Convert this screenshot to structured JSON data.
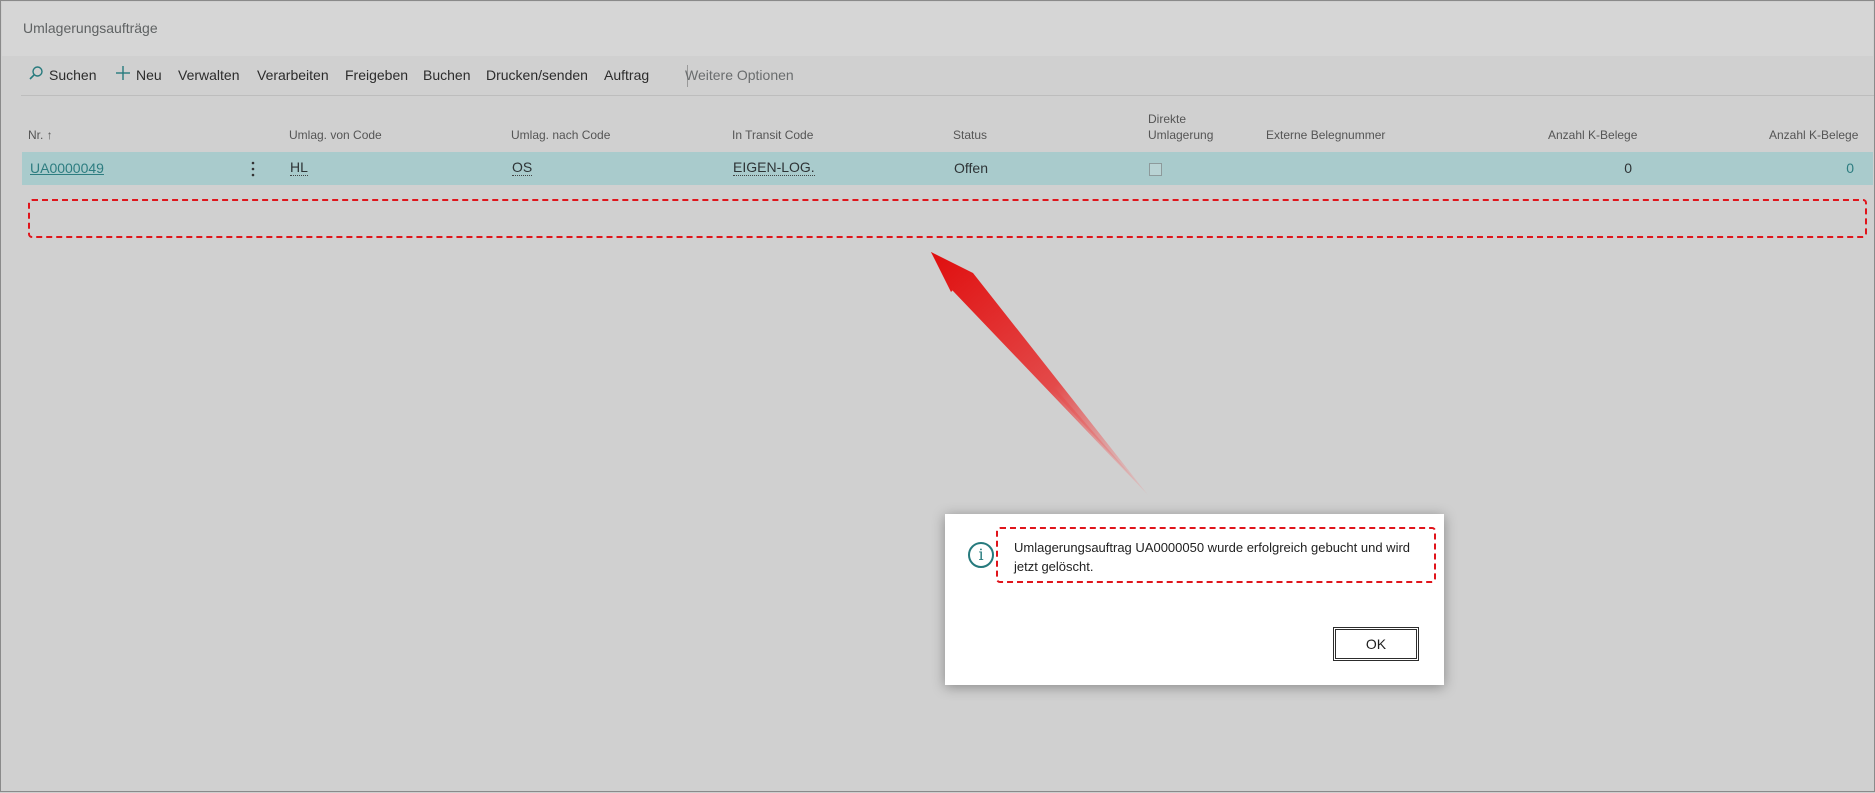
{
  "page": {
    "title": "Umlagerungsaufträge"
  },
  "actions": {
    "search": "Suchen",
    "new": "Neu",
    "manage": "Verwalten",
    "process": "Verarbeiten",
    "release": "Freigeben",
    "post": "Buchen",
    "print_send": "Drucken/senden",
    "order": "Auftrag",
    "more_options": "Weitere Optionen"
  },
  "table": {
    "columns": {
      "nr": "Nr. ↑",
      "from_code": "Umlag. von Code",
      "to_code": "Umlag. nach Code",
      "transit_code": "In Transit Code",
      "status": "Status",
      "direct_line1": "Direkte",
      "direct_line2": "Umlagerung",
      "external_doc": "Externe Belegnummer",
      "count_k1": "Anzahl K-Belege",
      "count_k2": "Anzahl K-Belege"
    },
    "rows": [
      {
        "nr": "UA0000049",
        "from_code": "HL",
        "to_code": "OS",
        "transit_code": "EIGEN-LOG.",
        "status": "Offen",
        "direct": false,
        "external_doc": "",
        "count_k1": "0",
        "count_k2": "0"
      }
    ]
  },
  "dialog": {
    "message": "Umlagerungsauftrag UA0000050 wurde erfolgreich gebucht und wird jetzt gelöscht.",
    "ok_label": "OK"
  },
  "colors": {
    "accent": "#267a7d",
    "row_selected": "#a9cbcc",
    "annotation_red": "#e0141b"
  }
}
